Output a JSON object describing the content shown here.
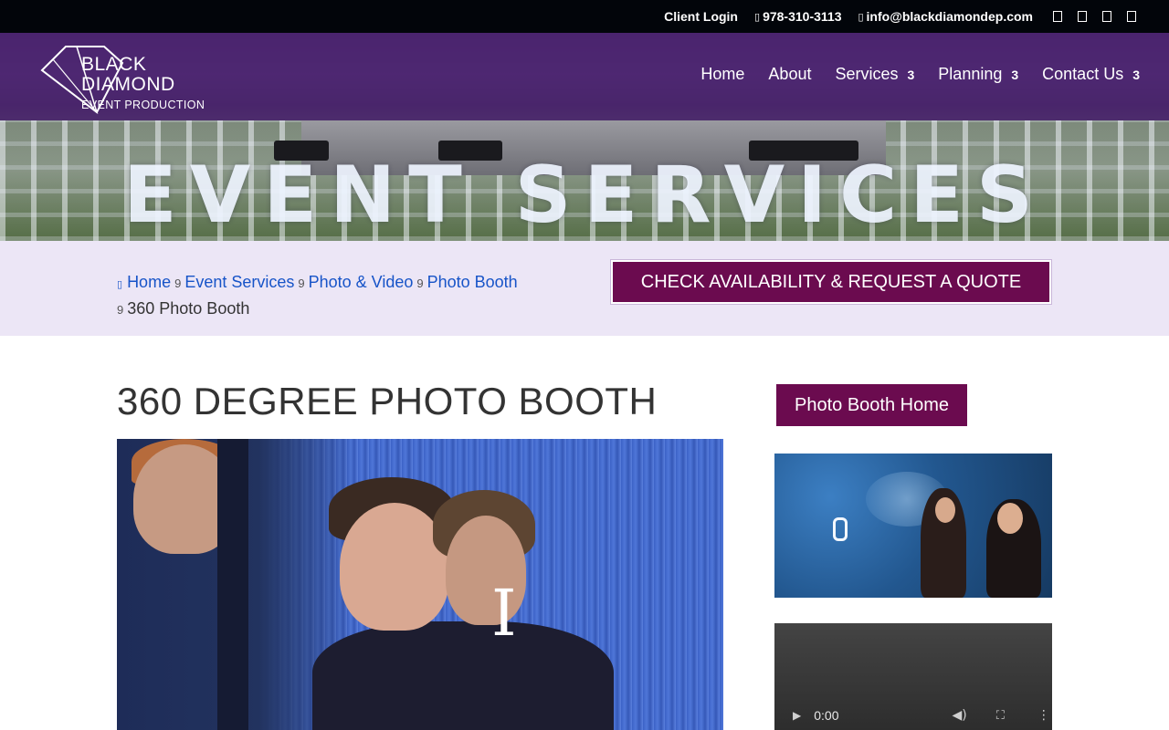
{
  "topbar": {
    "client_login": "Client Login",
    "phone": "978-310-3113",
    "email": "info@blackdiamondep.com",
    "phone_icon": "phone-icon",
    "email_icon": "mail-icon",
    "socials": [
      "facebook-icon",
      "twitter-icon",
      "instagram-icon",
      "youtube-icon"
    ]
  },
  "brand": {
    "line1": "BLACK",
    "line2": "DIAMOND",
    "sub": "EVENT PRODUCTION"
  },
  "nav": {
    "items": [
      {
        "label": "Home",
        "has_submenu": false
      },
      {
        "label": "About",
        "has_submenu": false
      },
      {
        "label": "Services",
        "has_submenu": true
      },
      {
        "label": "Planning",
        "has_submenu": true
      },
      {
        "label": "Contact Us",
        "has_submenu": true
      }
    ],
    "caret": "3"
  },
  "hero": {
    "title": "EVENT SERVICES"
  },
  "breadcrumb": {
    "items": [
      "Home",
      "Event Services",
      "Photo & Video",
      "Photo Booth"
    ],
    "current": "360 Photo Booth",
    "separator": "9"
  },
  "cta": {
    "quote_label": "CHECK AVAILABILITY & REQUEST A QUOTE"
  },
  "main": {
    "title": "360 DEGREE PHOTO BOOTH",
    "video_overlay": "I"
  },
  "sidebar": {
    "button_label": "Photo Booth Home",
    "video_time": "0:00"
  },
  "colors": {
    "accent": "#6b0b4f",
    "link": "#1754c8",
    "band": "#ece6f6",
    "topbar": "#02050a"
  }
}
